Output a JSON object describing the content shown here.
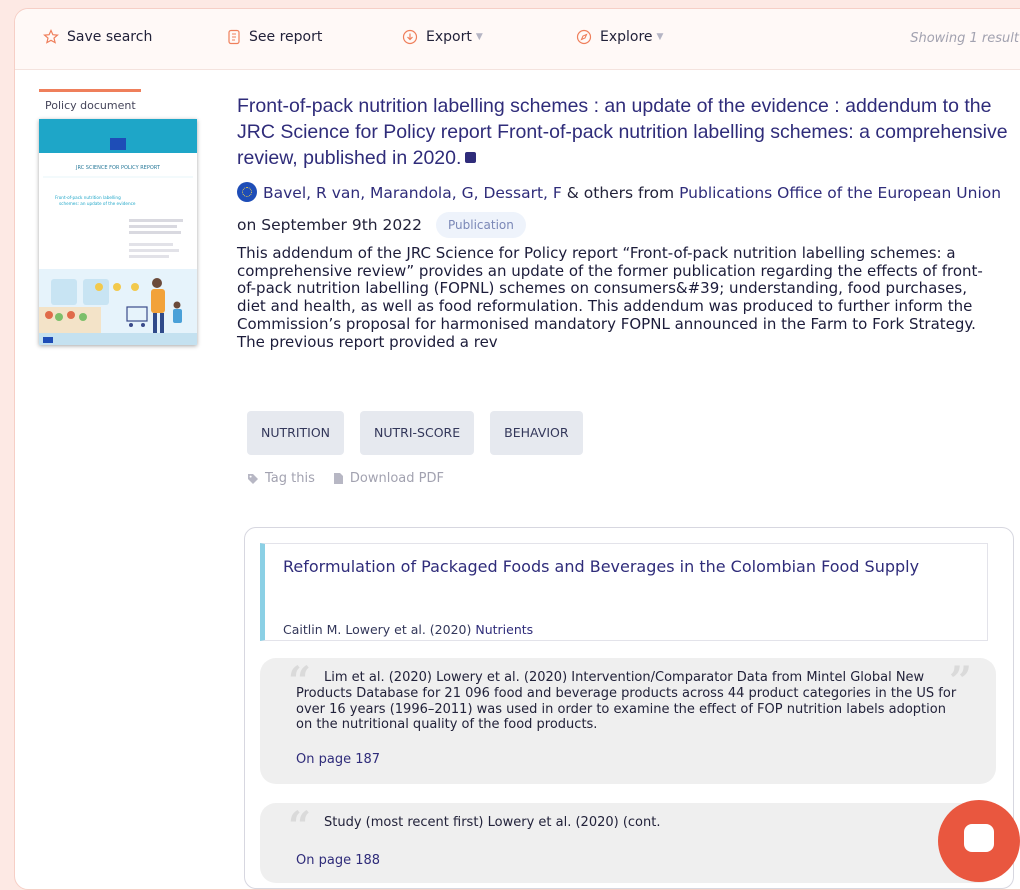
{
  "toolbar": {
    "save_search": "Save search",
    "see_report": "See report",
    "export": "Export",
    "explore": "Explore",
    "result_count": "Showing 1 result"
  },
  "result": {
    "type_label": "Policy document",
    "thumbnail": {
      "series": "JRC SCIENCE FOR POLICY REPORT",
      "title": "Front-of-pack nutrition labelling schemes: an update of the evidence"
    },
    "title": "Front-of-pack nutrition labelling schemes : an update of the evidence : addendum to the JRC Science for Policy report Front-of-pack nutrition labelling schemes: a comprehensive review, published in 2020.",
    "authors": "Bavel, R van, Marandola, G, Dessart, F",
    "others": "& others from",
    "publisher": "Publications Office of the European Union",
    "date_prefix": "on",
    "date": "September 9th 2022",
    "badge": "Publication",
    "abstract": "This addendum of the JRC Science for Policy report “Front-of-pack nutrition labelling schemes: a comprehensive review” provides an update of the former publication regarding the effects of front-of-pack nutrition labelling (FOPNL) schemes on consumers&#39; understanding, food purchases, diet and health, as well as food reformulation. This addendum was produced to further inform the Commission’s proposal for harmonised mandatory FOPNL announced in the Farm to Fork Strategy. The previous report provided a rev",
    "tags": [
      "NUTRITION",
      "NUTRI-SCORE",
      "BEHAVIOR"
    ],
    "tag_this": "Tag this",
    "download_pdf": "Download PDF"
  },
  "citation": {
    "title": "Reformulation of Packaged Foods and Beverages in the Colombian Food Supply",
    "authors_year": "Caitlin M. Lowery et al. (2020)",
    "journal": "Nutrients",
    "quotes": [
      {
        "text": "Lim et al. (2020) Lowery et al. (2020) Intervention/Comparator Data from Mintel Global New Products Database for 21 096 food and beverage products across 44 product categories in the US for over 16 years (1996–2011) was used in order to examine the effect of FOP nutrition labels adoption on the nutritional quality of the food products.",
        "page": "On page 187"
      },
      {
        "text": "Study (most recent first) Lowery et al. (2020) (cont.",
        "page": "On page 188"
      }
    ]
  },
  "colors": {
    "accent": "#ef7f5b",
    "link": "#2f2c7a",
    "chat": "#e9573f"
  },
  "icons": {
    "save": "star-outline-icon",
    "report": "document-icon",
    "export": "download-circle-icon",
    "explore": "compass-icon",
    "tag": "tag-icon",
    "pdf": "file-icon",
    "external": "external-link-icon",
    "chat": "chat-icon"
  }
}
